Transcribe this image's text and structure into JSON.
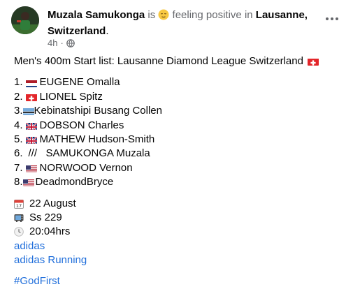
{
  "post": {
    "author": "Muzala Samukonga",
    "verb_prefix": " is ",
    "feeling": " feeling positive in ",
    "location": "Lausanne, Switzerland",
    "location_suffix": ".",
    "time": "4h",
    "dot": "·",
    "title": "Men's 400m Start list: Lausanne Diamond League  Switzerland",
    "start_list": [
      {
        "num": "1.",
        "flag": "netherlands-flag",
        "name": "EUGENE Omalla"
      },
      {
        "num": "2.",
        "flag": "switzerland-flag",
        "name": "LIONEL Spitz"
      },
      {
        "num": "3.",
        "flag": "botswana-flag",
        "name": "Kebinatshipi Busang Collen"
      },
      {
        "num": "4.",
        "flag": "uk-flag",
        "name": "DOBSON Charles"
      },
      {
        "num": "5.",
        "flag": "uk-flag",
        "name": "MATHEW Hudson-Smith"
      },
      {
        "num": "6.",
        "flag": "",
        "name": "///   SAMUKONGA Muzala"
      },
      {
        "num": "7.",
        "flag": "usa-flag",
        "name": "NORWOOD Vernon"
      },
      {
        "num": "8.",
        "flag": "usa-flag",
        "name": "DeadmondBryce"
      }
    ],
    "details": {
      "date": "22 August",
      "channel": "Ss 229",
      "time": "20:04hrs"
    },
    "links": [
      "adidas",
      "adidas Running"
    ],
    "hashtag": "#GodFirst"
  },
  "colors": {
    "link": "#216fdb",
    "muted": "#65676b",
    "text": "#050505"
  }
}
